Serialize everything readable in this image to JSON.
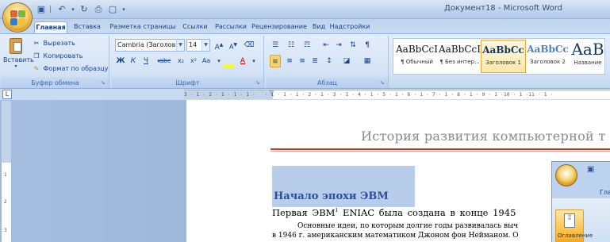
{
  "window": {
    "title": "Документ18 - Microsoft Word",
    "quick_access": [
      "save-icon",
      "undo-icon",
      "redo-icon",
      "print-preview-icon",
      "new-document-icon"
    ],
    "controls": [
      "minimize-icon",
      "maximize-icon",
      "close-icon"
    ]
  },
  "tabs": [
    "Главная",
    "Вставка",
    "Разметка страницы",
    "Ссылки",
    "Рассылки",
    "Рецензирование",
    "Вид",
    "Надстройки"
  ],
  "active_tab": "Главная",
  "clipboard": {
    "label": "Буфер обмена",
    "paste": "Вставить",
    "cut": "Вырезать",
    "copy": "Копировать",
    "format_painter": "Формат по образцу"
  },
  "font": {
    "label": "Шрифт",
    "font_name": "Cambria (Заголовки)",
    "font_size": "14",
    "bold": "Ж",
    "italic": "К",
    "underline": "Ч",
    "strikethrough": "abc",
    "subscript": "x₂",
    "superscript": "x²",
    "change_case": "Aa",
    "grow": "A",
    "shrink": "A"
  },
  "paragraph": {
    "label": "Абзац",
    "pilcrow": "¶"
  },
  "styles": {
    "items": [
      {
        "sample": "AaBbCcI",
        "name": "¶ Обычный"
      },
      {
        "sample": "AaBbCcI",
        "name": "¶ Без интер..."
      },
      {
        "sample": "AaBbCc",
        "name": "Заголовок 1"
      },
      {
        "sample": "AaBbCc",
        "name": "Заголовок 2"
      },
      {
        "sample": "AaB",
        "name": "Название"
      }
    ],
    "selected_index": 2,
    "colors": {
      "heading1": "#17365d",
      "heading2": "#4f81bd",
      "title": "#17365d"
    }
  },
  "ruler": {
    "toggle_icon": "ruler-toggle-icon",
    "h_ticks": "3 · 1 · 2 · 1 · 1 · 1 ·   · 1 · 1 · 1 · 2 · 1 · 3 · 1 · 4 · 1 · 5 · 1 · 6 · 1 · 7 · 1 · 8 · 1 · 9 · 1 ·10 · 1 ·11 · 1 ·",
    "v_ticks": [
      "1",
      "2",
      "3"
    ]
  },
  "document": {
    "title": "История развития компьютерной т",
    "heading": "Начало эпохи ЭВМ",
    "para1_a": "Первая ЭВМ",
    "para1_sup": "1",
    "para1_b": " ENIAC была  создана в конце 1945",
    "para2": "Основные идеи, по которым долгие годы развивалась выч",
    "para3": "в 1946 г. американским математиком Джоном фон Нейманом. О",
    "accent_color": "#b3402c",
    "heading_color": "#2b4f9b"
  },
  "inset_window": {
    "tab": "Гла",
    "button": "Оглавление"
  }
}
